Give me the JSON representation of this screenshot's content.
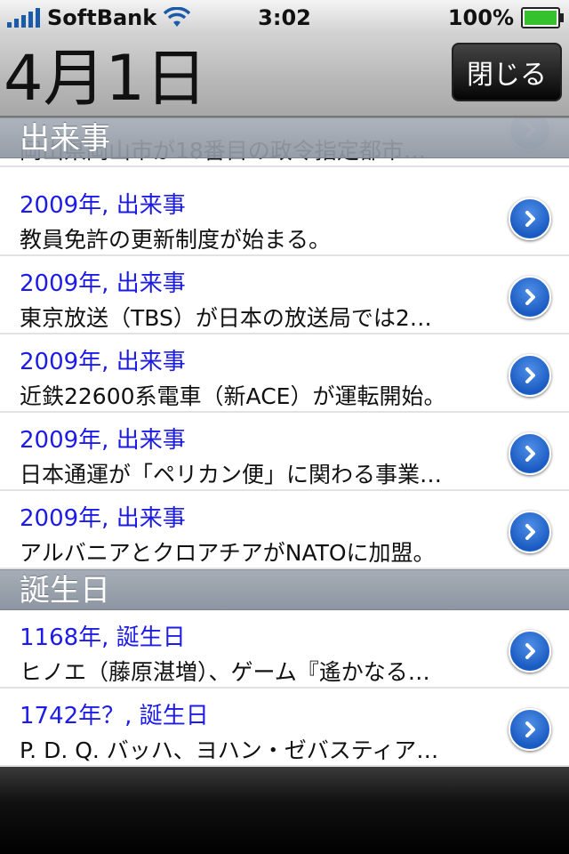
{
  "status": {
    "carrier": "SoftBank",
    "time": "3:02",
    "battery": "100%"
  },
  "nav": {
    "title": "4月1日",
    "close_label": "閉じる"
  },
  "partial_row": {
    "line2": "岡山県岡山市が18番目の政令指定都市…"
  },
  "sections": [
    {
      "header": "出来事",
      "rows": [
        {
          "line1": "2009年, 出来事",
          "line2": "教員免許の更新制度が始まる。"
        },
        {
          "line1": "2009年, 出来事",
          "line2": "東京放送（TBS）が日本の放送局では2…"
        },
        {
          "line1": "2009年, 出来事",
          "line2": "近鉄22600系電車（新ACE）が運転開始。"
        },
        {
          "line1": "2009年, 出来事",
          "line2": "日本通運が「ペリカン便」に関わる事業…"
        },
        {
          "line1": "2009年, 出来事",
          "line2": "アルバニアとクロアチアがNATOに加盟。"
        }
      ]
    },
    {
      "header": "誕生日",
      "rows": [
        {
          "line1": "1168年, 誕生日",
          "line2": "ヒノエ（藤原湛増）、ゲーム『遙かなる…"
        },
        {
          "line1": "1742年？, 誕生日",
          "line2": "P. D. Q. バッハ、ヨハン・ゼバスティア…"
        }
      ]
    }
  ]
}
